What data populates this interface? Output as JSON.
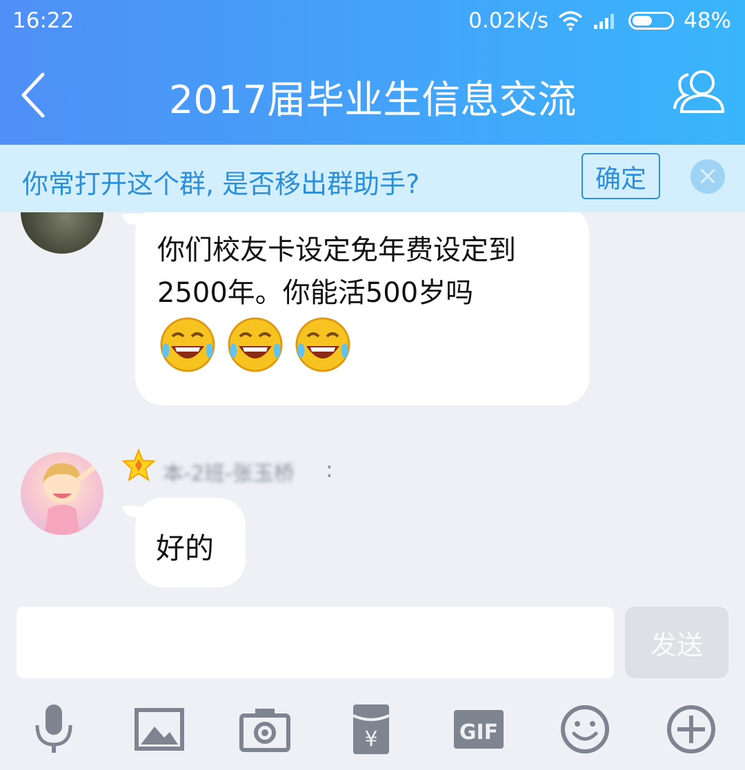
{
  "status_bar": {
    "time": "16:22",
    "speed": "0.02K/s",
    "battery": "48%"
  },
  "header": {
    "title": "2017届毕业生信息交流"
  },
  "notice": {
    "text": "你常打开这个群, 是否移出群助手?",
    "confirm_label": "确定"
  },
  "messages": [
    {
      "text": "你们校友卡设定免年费设定到2500年。你能活500岁吗",
      "emoji_count": 3,
      "emoji": "laugh-cry-emoji"
    },
    {
      "sender": "本-2班-张玉桥",
      "colon": ":",
      "text": "好的"
    }
  ],
  "input": {
    "placeholder": "",
    "send_label": "发送"
  },
  "toolbar": [
    "microphone-icon",
    "image-icon",
    "camera-icon",
    "red-packet-icon",
    "gif-icon",
    "emoji-icon",
    "plus-icon"
  ],
  "colors": {
    "header_start": "#4f8ff7",
    "header_end": "#39b5fb",
    "notice_bg": "#d3eefc",
    "notice_text": "#2b8fd9"
  }
}
